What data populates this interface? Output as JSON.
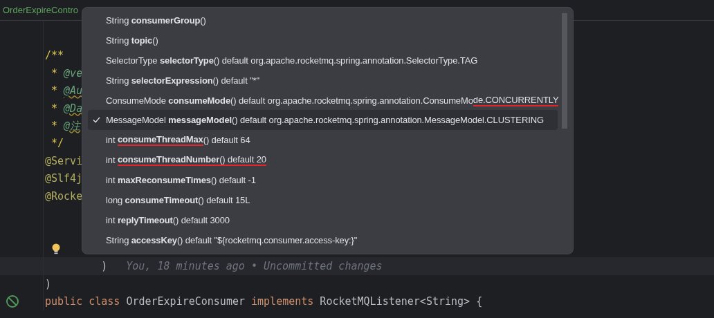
{
  "editor_tabs": [
    {
      "label": "OrderExpireContro",
      "modified": true
    }
  ],
  "code_lines": [
    {
      "kind": "blank"
    },
    {
      "kind": "blank"
    },
    {
      "tokens": [
        {
          "text": "/**",
          "kind": "comment"
        }
      ]
    },
    {
      "tokens": [
        {
          "text": " * ",
          "kind": "comment"
        },
        {
          "text": "@ve",
          "kind": "doc-tag",
          "typo": false
        }
      ]
    },
    {
      "tokens": [
        {
          "text": " * ",
          "kind": "comment"
        },
        {
          "text": "@Au",
          "kind": "doc-tag",
          "typo": true
        }
      ]
    },
    {
      "tokens": [
        {
          "text": " * ",
          "kind": "comment"
        },
        {
          "text": "@Da",
          "kind": "doc-tag",
          "typo": true
        }
      ]
    },
    {
      "tokens": [
        {
          "text": " * ",
          "kind": "comment"
        },
        {
          "text": "@注",
          "kind": "doc-tag",
          "typo": true
        }
      ]
    },
    {
      "tokens": [
        {
          "text": " */",
          "kind": "comment"
        }
      ]
    },
    {
      "tokens": [
        {
          "text": "@Servi",
          "kind": "annotation"
        }
      ]
    },
    {
      "tokens": [
        {
          "text": "@Slf4j",
          "kind": "annotation"
        }
      ]
    },
    {
      "tokens": [
        {
          "text": "@Rocke",
          "kind": "annotation"
        }
      ]
    },
    {
      "kind": "blank"
    },
    {
      "kind": "blank"
    },
    {
      "bulb": true
    },
    {
      "tokens": [
        {
          "text": "         )",
          "kind": "plain"
        }
      ],
      "current": true,
      "blame": "You, 18 minutes ago • Uncommitted changes"
    },
    {
      "tokens": [
        {
          "text": ")",
          "kind": "plain"
        }
      ]
    },
    {
      "tokens": [
        {
          "text": "public class",
          "kind": "keyword"
        },
        {
          "text": " OrderExpireConsumer ",
          "kind": "plain"
        },
        {
          "text": "implements",
          "kind": "keyword"
        },
        {
          "text": " RocketMQListener<String> {",
          "kind": "plain"
        }
      ],
      "gutter_icon": true
    }
  ],
  "completion_popup": {
    "items": [
      {
        "selected": false,
        "segments": [
          {
            "text": "String ",
            "bold": false,
            "underlined": false
          },
          {
            "text": "consumerGroup",
            "bold": true,
            "underlined": false
          },
          {
            "text": "()",
            "bold": false,
            "underlined": false
          }
        ]
      },
      {
        "selected": false,
        "segments": [
          {
            "text": "String ",
            "bold": false,
            "underlined": false
          },
          {
            "text": "topic",
            "bold": true,
            "underlined": false
          },
          {
            "text": "()",
            "bold": false,
            "underlined": false
          }
        ]
      },
      {
        "selected": false,
        "segments": [
          {
            "text": "SelectorType ",
            "bold": false,
            "underlined": false
          },
          {
            "text": "selectorType",
            "bold": true,
            "underlined": false
          },
          {
            "text": "() default org.apache.rocketmq.spring.annotation.SelectorType.TAG",
            "bold": false,
            "underlined": false
          }
        ]
      },
      {
        "selected": false,
        "segments": [
          {
            "text": "String ",
            "bold": false,
            "underlined": false
          },
          {
            "text": "selectorExpression",
            "bold": true,
            "underlined": false
          },
          {
            "text": "() default \"*\"",
            "bold": false,
            "underlined": false
          }
        ]
      },
      {
        "selected": false,
        "segments": [
          {
            "text": "ConsumeMode ",
            "bold": false,
            "underlined": false
          },
          {
            "text": "consumeMode",
            "bold": true,
            "underlined": false
          },
          {
            "text": "() default org.apache.rocketmq.spring.annotation.ConsumeMo",
            "bold": false,
            "underlined": false
          },
          {
            "text": "de.CONCURRENTLY",
            "bold": false,
            "underlined": true
          }
        ]
      },
      {
        "selected": true,
        "segments": [
          {
            "text": "MessageModel ",
            "bold": false,
            "underlined": false
          },
          {
            "text": "messageModel",
            "bold": true,
            "underlined": false
          },
          {
            "text": "() default org.apache.rocketmq.spring.annotation.MessageModel.CLUSTERING",
            "bold": false,
            "underlined": false
          }
        ]
      },
      {
        "selected": false,
        "segments": [
          {
            "text": "int ",
            "bold": false,
            "underlined": false
          },
          {
            "text": "consumeThreadMax",
            "bold": true,
            "underlined": true
          },
          {
            "text": "() default 64",
            "bold": false,
            "underlined": false
          }
        ]
      },
      {
        "selected": false,
        "segments": [
          {
            "text": "int ",
            "bold": false,
            "underlined": false
          },
          {
            "text": "consumeThreadNumber",
            "bold": true,
            "underlined": true
          },
          {
            "text": "() default 20",
            "bold": false,
            "underlined": true
          }
        ]
      },
      {
        "selected": false,
        "segments": [
          {
            "text": "int ",
            "bold": false,
            "underlined": false
          },
          {
            "text": "maxReconsumeTimes",
            "bold": true,
            "underlined": false
          },
          {
            "text": "() default -1",
            "bold": false,
            "underlined": false
          }
        ]
      },
      {
        "selected": false,
        "segments": [
          {
            "text": "long ",
            "bold": false,
            "underlined": false
          },
          {
            "text": "consumeTimeout",
            "bold": true,
            "underlined": false
          },
          {
            "text": "() default 15L",
            "bold": false,
            "underlined": false
          }
        ]
      },
      {
        "selected": false,
        "segments": [
          {
            "text": "int ",
            "bold": false,
            "underlined": false
          },
          {
            "text": "replyTimeout",
            "bold": true,
            "underlined": false
          },
          {
            "text": "() default 3000",
            "bold": false,
            "underlined": false
          }
        ]
      },
      {
        "selected": false,
        "segments": [
          {
            "text": "String ",
            "bold": false,
            "underlined": false
          },
          {
            "text": "accessKey",
            "bold": true,
            "underlined": false
          },
          {
            "text": "() default \"${rocketmq.consumer.access-key:}\"",
            "bold": false,
            "underlined": false
          }
        ]
      }
    ]
  }
}
